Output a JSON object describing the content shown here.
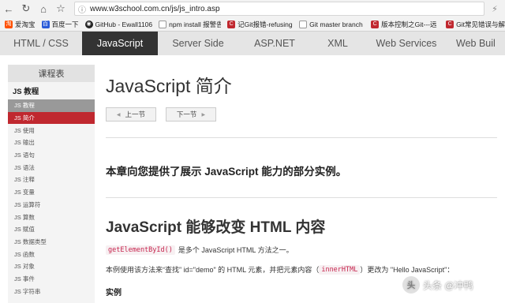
{
  "browser": {
    "url": "www.w3school.com.cn/js/js_intro.asp",
    "bookmarks": [
      {
        "label": "爱淘宝",
        "color": "#ff5000"
      },
      {
        "label": "百度一下",
        "color": "#2a5bd8"
      },
      {
        "label": "GitHub - Ewall1106",
        "color": "#222222"
      },
      {
        "label": "npm install 报警告",
        "color": "#888888"
      },
      {
        "label": "记Git报错-refusing",
        "color": "#c0282f"
      },
      {
        "label": "Git master branch",
        "color": "#777777"
      },
      {
        "label": "版本控制之Git---远",
        "color": "#c0282f"
      },
      {
        "label": "Git常见错误与解",
        "color": "#c0282f"
      }
    ]
  },
  "sitenav": {
    "items": [
      "HTML / CSS",
      "JavaScript",
      "Server Side",
      "ASP.NET",
      "XML",
      "Web Services",
      "Web Buil"
    ],
    "active_index": 1
  },
  "sidebar": {
    "heading": "课程表",
    "section_title": "JS 教程",
    "items": [
      "JS 教程",
      "JS 简介",
      "JS 使用",
      "JS 输出",
      "JS 语句",
      "JS 语法",
      "JS 注释",
      "JS 变量",
      "JS 运算符",
      "JS 算数",
      "JS 赋值",
      "JS 数据类型",
      "JS 函数",
      "JS 对象",
      "JS 事件",
      "JS 字符串"
    ]
  },
  "main": {
    "title": "JavaScript 简介",
    "prev_label": "上一节",
    "next_label": "下一节",
    "intro": "本章向您提供了展示 JavaScript 能力的部分实例。",
    "section_heading": "JavaScript 能够改变 HTML 内容",
    "para1_code": "getElementById()",
    "para1_text": "是多个 JavaScript HTML 方法之一。",
    "para2_pre": "本例使用该方法来“查找” id=\"demo\" 的 HTML 元素，并把元素内容（",
    "para2_code": "innerHTML",
    "para2_post": "）更改为 \"Hello JavaScript\"：",
    "example_heading": "实例"
  },
  "watermark": {
    "logo_glyph": "头",
    "text": "头条 @冲鸭"
  }
}
